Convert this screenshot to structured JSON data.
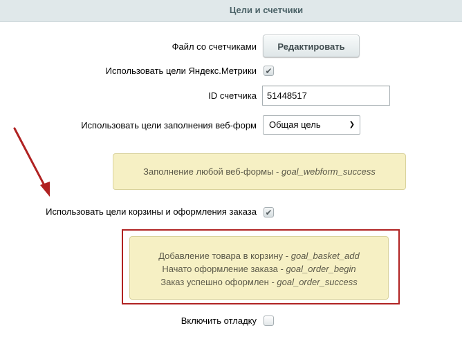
{
  "section": {
    "title": "Цели и счетчики"
  },
  "fields": {
    "counters_file_label": "Файл со счетчиками",
    "edit_button_label": "Редактировать",
    "use_metrika_goals_label": "Использовать цели Яндекс.Метрики",
    "use_metrika_goals_checked": true,
    "counter_id_label": "ID счетчика",
    "counter_id_value": "51448517",
    "webform_goals_label": "Использовать цели заполнения веб-форм",
    "webform_goals_selected": "Общая цель",
    "basket_goals_label": "Использовать цели корзины и оформления заказа",
    "basket_goals_checked": true,
    "debug_label": "Включить отладку",
    "debug_checked": false
  },
  "notes": {
    "webform": {
      "text": "Заполнение любой веб-формы - ",
      "code": "goal_webform_success"
    },
    "basket": [
      {
        "text": "Добавление товара в корзину - ",
        "code": "goal_basket_add"
      },
      {
        "text": "Начато оформление заказа - ",
        "code": "goal_order_begin"
      },
      {
        "text": "Заказ успешно оформлен - ",
        "code": "goal_order_success"
      }
    ]
  },
  "icons": {
    "checkmark": "check-icon",
    "dropdown": "chevron-down-icon",
    "pointer_arrow": "arrow-icon"
  },
  "colors": {
    "header_bg": "#e0e8ea",
    "header_text": "#4b6267",
    "note_bg": "#f6f0c4",
    "highlight_frame": "#b02222",
    "annotation_arrow": "#b02222"
  }
}
